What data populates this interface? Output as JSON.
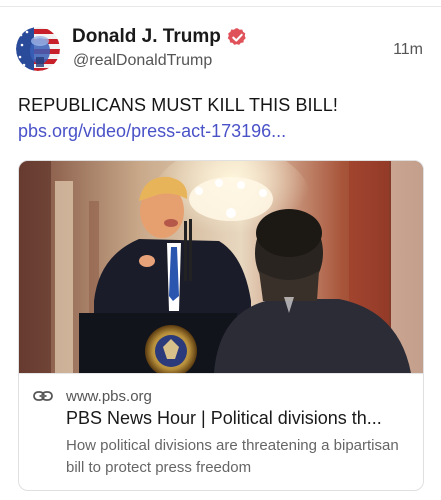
{
  "post": {
    "author": {
      "display_name": "Donald J. Trump",
      "handle": "@realDonaldTrump",
      "verified": true,
      "avatar_icon": "flag-portrait-avatar"
    },
    "timestamp": "11m",
    "text": "REPUBLICANS MUST KILL THIS BILL!",
    "link_text": "pbs.org/video/press-act-173196..."
  },
  "link_card": {
    "image_icon": "press-conference-photo",
    "link_icon": "chain-link-icon",
    "domain": "www.pbs.org",
    "title": "PBS News Hour | Political divisions th...",
    "description": "How political divisions are threatening a bipartisan bill to protect press freedom"
  },
  "colors": {
    "link": "#4a52c8",
    "verified_badge": "#e0525a",
    "muted_text": "#555555"
  }
}
